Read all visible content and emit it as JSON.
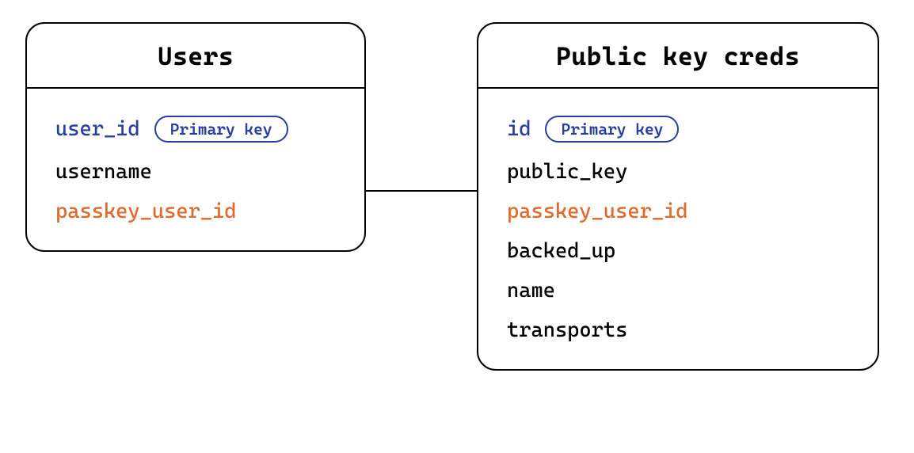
{
  "entities": {
    "users": {
      "title": "Users",
      "fields": [
        {
          "name": "user_id",
          "role": "primary_key",
          "badge": "Primary key"
        },
        {
          "name": "username",
          "role": "attribute"
        },
        {
          "name": "passkey_user_id",
          "role": "foreign_key"
        }
      ]
    },
    "creds": {
      "title": "Public key creds",
      "fields": [
        {
          "name": "id",
          "role": "primary_key",
          "badge": "Primary key"
        },
        {
          "name": "public_key",
          "role": "attribute"
        },
        {
          "name": "passkey_user_id",
          "role": "foreign_key"
        },
        {
          "name": "backed_up",
          "role": "attribute"
        },
        {
          "name": "name",
          "role": "attribute"
        },
        {
          "name": "transports",
          "role": "attribute"
        }
      ]
    }
  },
  "relationship": {
    "from_entity": "users",
    "from_field": "passkey_user_id",
    "to_entity": "creds",
    "to_field": "passkey_user_id"
  },
  "colors": {
    "primary_key": "#2a3ea0",
    "foreign_key": "#e06a2b",
    "border": "#000000"
  }
}
